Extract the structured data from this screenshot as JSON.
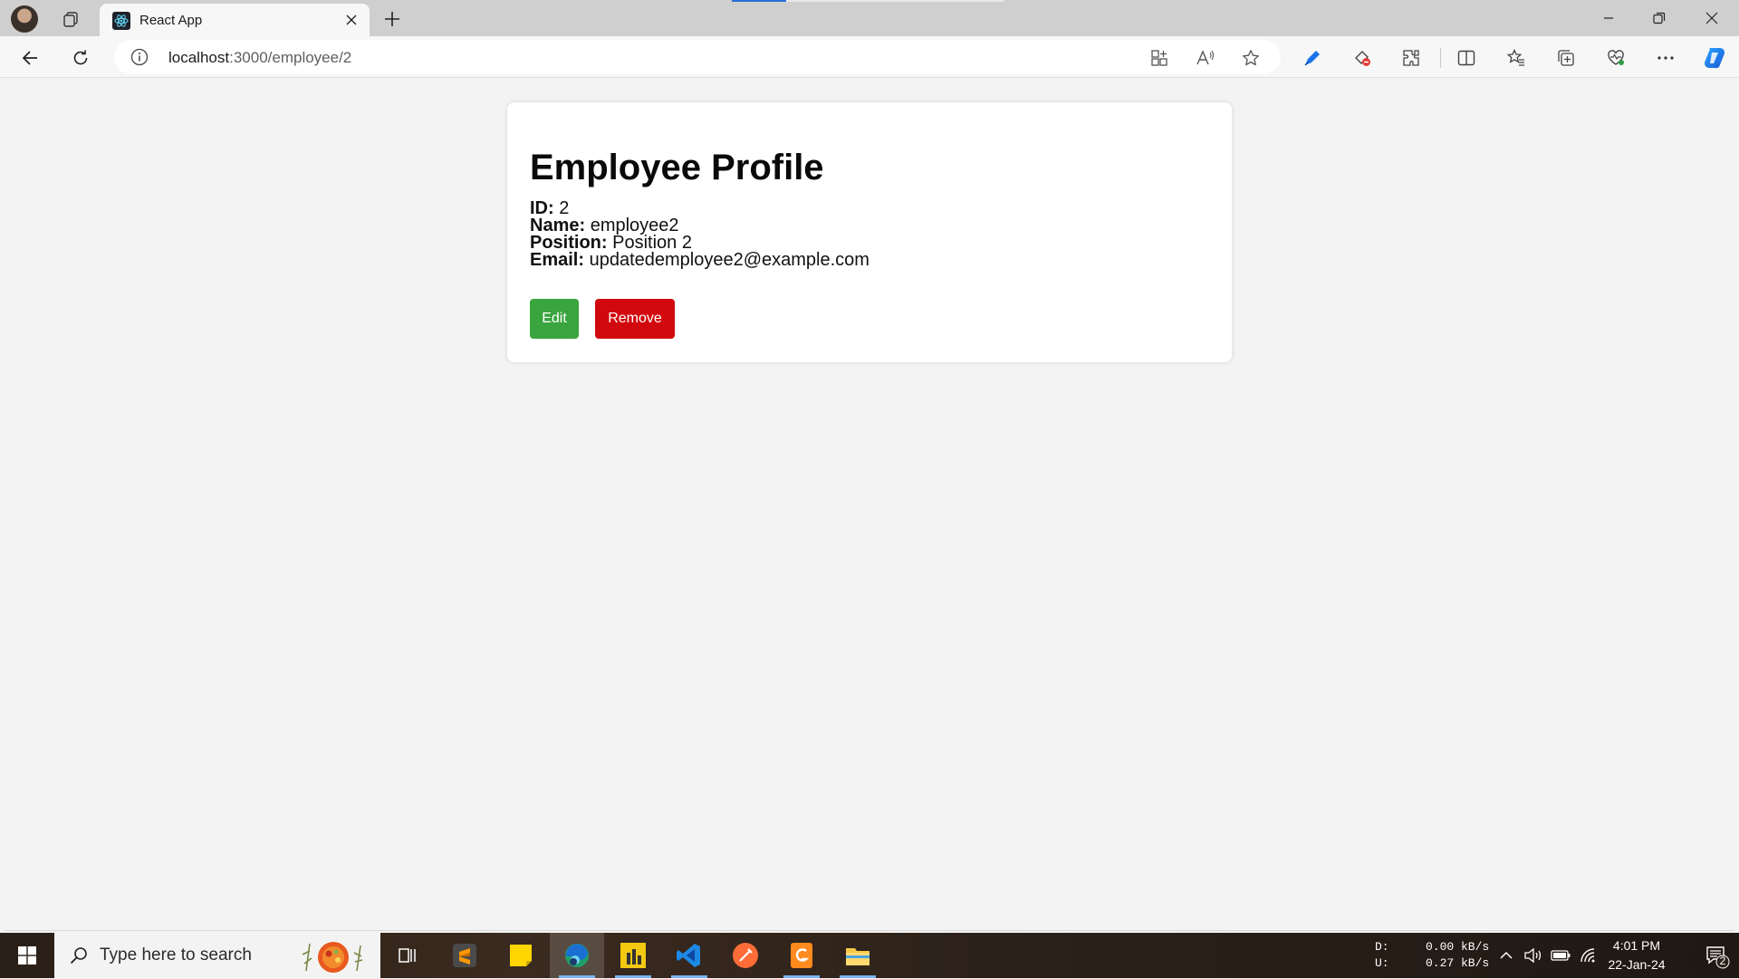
{
  "browser": {
    "tab_title": "React App",
    "url_host": "localhost",
    "url_path": ":3000/employee/2"
  },
  "profile": {
    "title": "Employee Profile",
    "fields": [
      {
        "label": "ID:",
        "value": " 2"
      },
      {
        "label": "Name:",
        "value": " employee2"
      },
      {
        "label": "Position:",
        "value": " Position 2"
      },
      {
        "label": "Email:",
        "value": " updatedemployee2@example.com"
      }
    ],
    "edit_label": "Edit",
    "remove_label": "Remove"
  },
  "taskbar": {
    "search_placeholder": "Type here to search",
    "net_down_label": "D:",
    "net_up_label": "U:",
    "net_down_value": "0.00 kB/s",
    "net_up_value": "0.27 kB/s",
    "time": "4:01 PM",
    "date": "22-Jan-24",
    "notification_count": "2"
  },
  "colors": {
    "edit_button": "#3aa43e",
    "remove_button": "#d1090e",
    "page_background": "#f3f3f3",
    "accent": "#2b6fd6"
  },
  "icons": [
    "profile-avatar",
    "workspaces-icon",
    "react-favicon",
    "close-icon",
    "plus-icon",
    "minimize-icon",
    "restore-icon",
    "back-icon",
    "refresh-icon",
    "info-icon",
    "app-available-icon",
    "read-aloud-icon",
    "favorite-star-icon",
    "pen-icon",
    "tracking-icon",
    "extensions-icon",
    "split-screen-icon",
    "favorites-icon",
    "collections-icon",
    "browser-essentials-icon",
    "more-icon",
    "copilot-icon",
    "windows-start-icon",
    "search-icon",
    "task-view-icon",
    "sublime-text-icon",
    "sticky-notes-icon",
    "edge-icon",
    "power-bi-icon",
    "vscode-icon",
    "postman-icon",
    "pdf-app-icon",
    "file-explorer-icon",
    "chevron-up-icon",
    "volume-icon",
    "battery-icon",
    "wifi-icon",
    "notification-icon"
  ]
}
